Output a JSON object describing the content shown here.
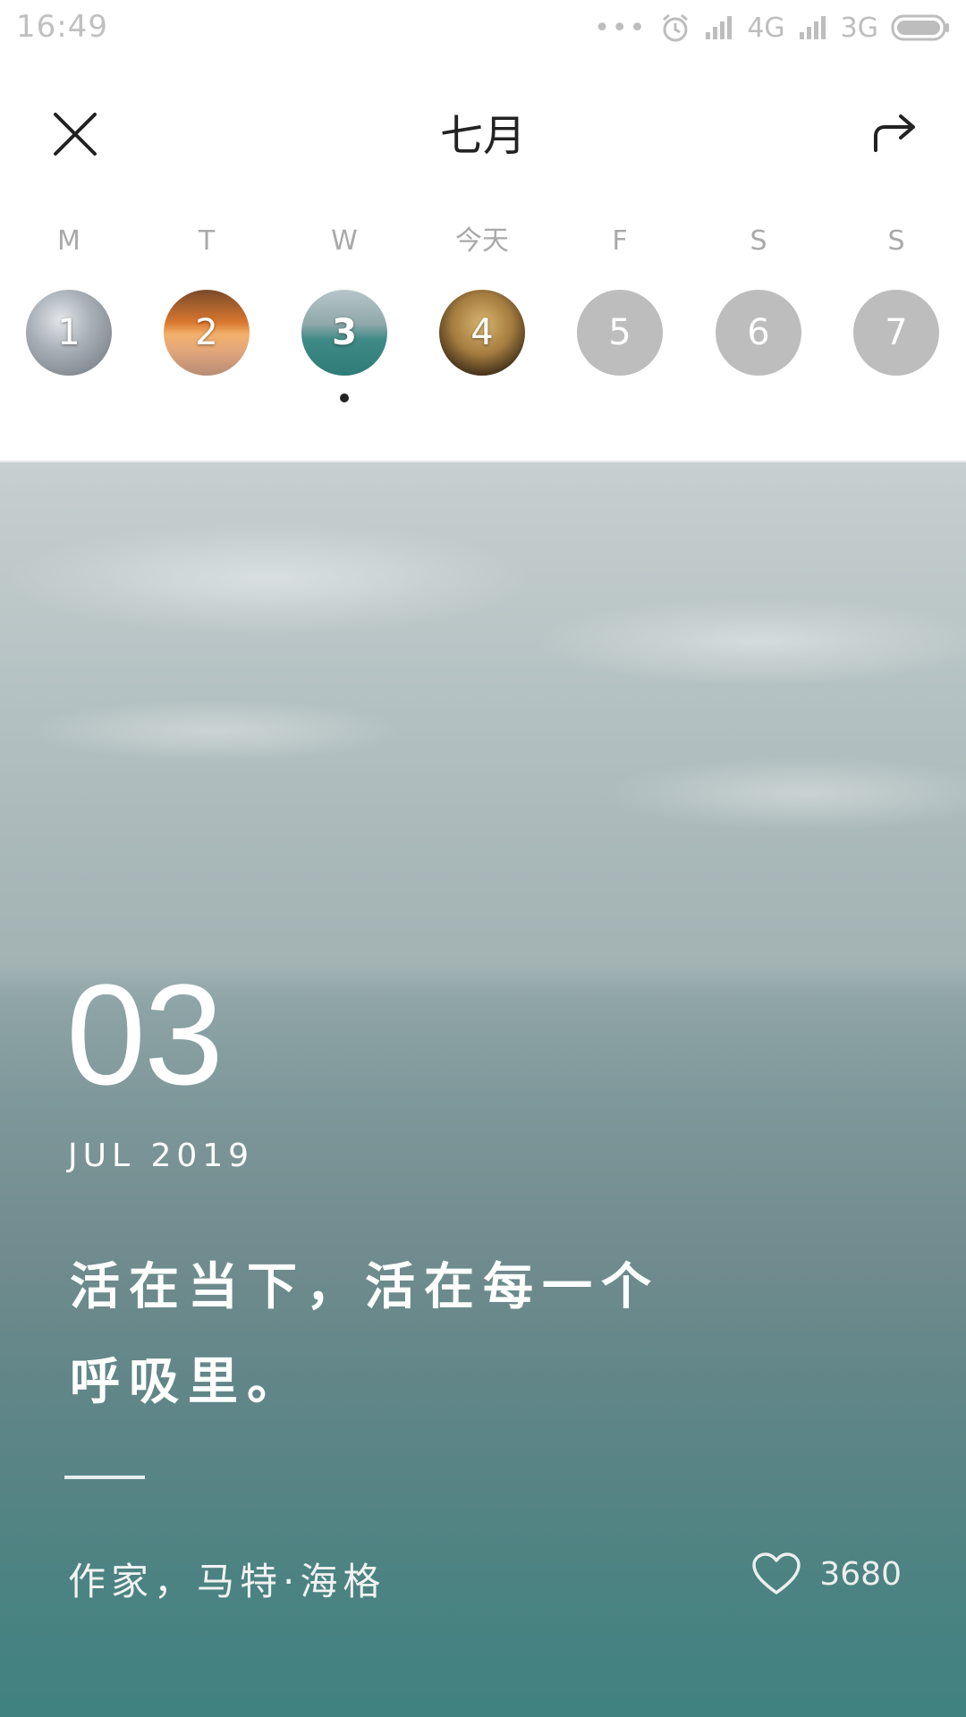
{
  "status_bar": {
    "time": "16:49",
    "dots": "•••",
    "network_1": "4G",
    "network_2": "3G",
    "icons": [
      "alarm-icon",
      "signal-icon",
      "battery-icon"
    ]
  },
  "header": {
    "title": "七月",
    "close_icon": "close-icon",
    "share_icon": "share-icon"
  },
  "week": {
    "days": [
      {
        "label": "M",
        "number": "1"
      },
      {
        "label": "T",
        "number": "2"
      },
      {
        "label": "W",
        "number": "3"
      },
      {
        "label": "今天",
        "number": "4"
      },
      {
        "label": "F",
        "number": "5"
      },
      {
        "label": "S",
        "number": "6"
      },
      {
        "label": "S",
        "number": "7"
      }
    ],
    "selected_index": 2
  },
  "card": {
    "day": "03",
    "month_year": "JUL 2019",
    "quote_line1": "活在当下，活在每一个",
    "quote_line2": "呼吸里。",
    "author": "作家，马特·海格",
    "like_count": "3680",
    "like_icon": "heart-icon"
  },
  "colors": {
    "accent_dark": "#222222",
    "muted_label": "#a9a9a9",
    "future_day": "#bdbdbd",
    "sea_teal": "#3f8280"
  }
}
